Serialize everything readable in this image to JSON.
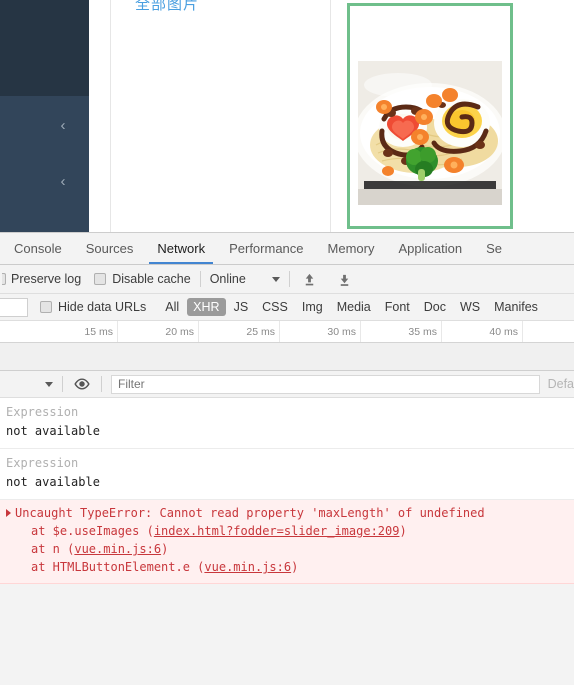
{
  "page": {
    "sidebar": {
      "collapse_icons": [
        "chevron-left-icon",
        "chevron-left-icon"
      ],
      "collapse_glyph": "‹",
      "top_color": "#263544",
      "bottom_color": "#32455a"
    },
    "panel_heading": "全部图片",
    "panel_heading_color": "#4a9fe0",
    "image_card": {
      "border_color": "#6fbf8b",
      "alt": "plate of spaghetti with omelette, ketchup heart, broccoli and carrot flowers"
    }
  },
  "devtools": {
    "tabs": [
      {
        "label": "Console",
        "active": false
      },
      {
        "label": "Sources",
        "active": false
      },
      {
        "label": "Network",
        "active": true
      },
      {
        "label": "Performance",
        "active": false
      },
      {
        "label": "Memory",
        "active": false
      },
      {
        "label": "Application",
        "active": false
      },
      {
        "label": "Se",
        "active": false
      }
    ],
    "active_tab_underline_color": "#4285d1",
    "network_toolbar": {
      "preserve_log_label": "Preserve log",
      "preserve_log_checked": false,
      "disable_cache_label": "Disable cache",
      "disable_cache_checked": false,
      "throttling_value": "Online",
      "throttling_caret": "chevron-down-icon",
      "import_icon": "upload-arrow-icon",
      "export_icon": "download-arrow-icon"
    },
    "filter_bar": {
      "search_value": "",
      "hide_data_urls_label": "Hide data URLs",
      "hide_data_urls_checked": false,
      "types": [
        {
          "label": "All",
          "selected": false
        },
        {
          "label": "XHR",
          "selected": true
        },
        {
          "label": "JS",
          "selected": false
        },
        {
          "label": "CSS",
          "selected": false
        },
        {
          "label": "Img",
          "selected": false
        },
        {
          "label": "Media",
          "selected": false
        },
        {
          "label": "Font",
          "selected": false
        },
        {
          "label": "Doc",
          "selected": false
        },
        {
          "label": "WS",
          "selected": false
        },
        {
          "label": "Manifes",
          "selected": false
        }
      ],
      "selected_chip_bg": "#9b9b9b"
    },
    "timeline": {
      "ticks": [
        "15 ms",
        "20 ms",
        "25 ms",
        "30 ms",
        "35 ms",
        "40 ms"
      ]
    },
    "console_toolbar": {
      "levels_caret": "chevron-down-icon",
      "eye_icon": "eye-icon",
      "filter_placeholder": "Filter",
      "filter_value": "",
      "level_label": "Defa"
    },
    "console_rows": [
      {
        "label": "Expression",
        "value": "not available"
      },
      {
        "label": "Expression",
        "value": "not available"
      }
    ],
    "error": {
      "expand_icon": "triangle-right-icon",
      "message": "Uncaught TypeError: Cannot read property 'maxLength' of undefined",
      "stack": [
        {
          "prefix": "at $e.useImages (",
          "link": "index.html?fodder=slider_image:209",
          "suffix": ")"
        },
        {
          "prefix": "at n (",
          "link": "vue.min.js:6",
          "suffix": ")"
        },
        {
          "prefix": "at HTMLButtonElement.e (",
          "link": "vue.min.js:6",
          "suffix": ")"
        }
      ],
      "bg_color": "#fff0f0",
      "text_color": "#c8373c"
    }
  }
}
